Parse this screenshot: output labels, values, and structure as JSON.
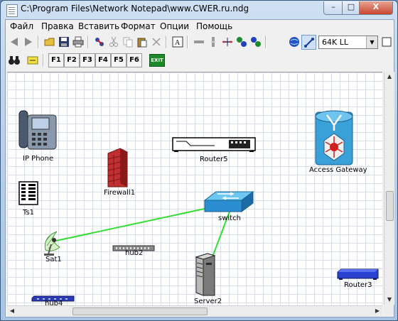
{
  "window": {
    "title": "C:\\Program Files\\Network Notepad\\www.CWER.ru.ndg",
    "minimize": "–",
    "maximize": "□",
    "close": "X"
  },
  "menu": {
    "items": [
      "Файл",
      "Правка",
      "Вставить",
      "Формат",
      "Опции",
      "Помощь"
    ]
  },
  "toolbar": {
    "line_speed": "64K LL",
    "function_keys": [
      "F1",
      "F2",
      "F3",
      "F4",
      "F5",
      "F6"
    ],
    "exit_label": "EXIT"
  },
  "canvas": {
    "devices": {
      "ip_phone": "IP Phone",
      "router5": "Router5",
      "access_gateway": "Access Gateway",
      "firewall1": "Firewall1",
      "ts1": "Ts1",
      "switch": "switch",
      "sat1": "Sat1",
      "hub2": "hub2",
      "server2": "Server2",
      "hub4": "hub4",
      "router3": "Router3"
    },
    "link_color": "#33dd33"
  }
}
